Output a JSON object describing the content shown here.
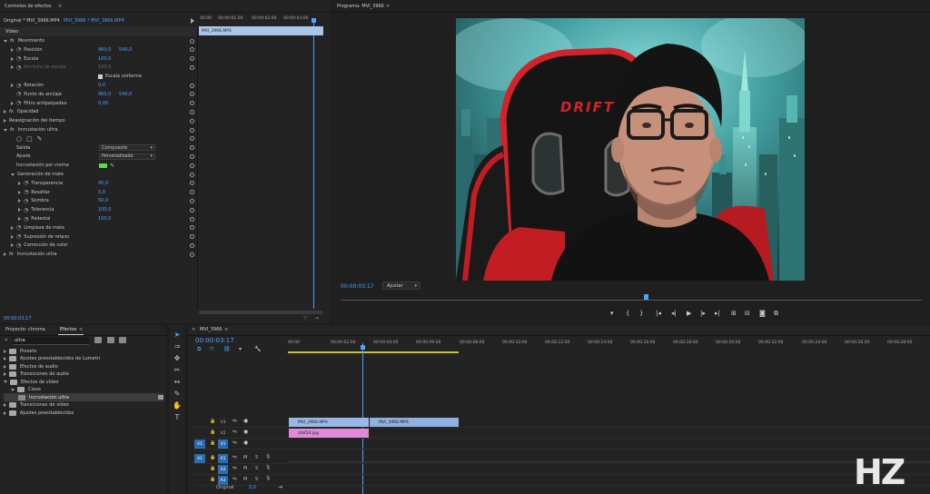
{
  "effect_controls": {
    "tab_title": "Controles de efectos",
    "source_label": "Original * MVI_3966.MP4",
    "seq_label": "MVI_3966 * MVI_3966.MP4",
    "timecodes": [
      "00:00",
      "00:00:01:00",
      "00:00:02:00",
      "00:00:03:00"
    ],
    "clip_label": "MVI_3966.MP4",
    "section_video": "Vídeo",
    "current_time": "00:00:03:17",
    "rows": [
      {
        "indent": 1,
        "exp": "down",
        "fx": true,
        "label": "Movimiento",
        "v1": "",
        "v2": ""
      },
      {
        "indent": 2,
        "exp": "right",
        "fx": false,
        "label": "Posición",
        "v1": "960,0",
        "v2": "540,0"
      },
      {
        "indent": 2,
        "exp": "right",
        "fx": false,
        "label": "Escala",
        "v1": "100,0",
        "v2": ""
      },
      {
        "indent": 2,
        "exp": "right",
        "fx": false,
        "label": "Anchura de escala",
        "v1": "100,0",
        "v2": "",
        "dim": true
      },
      {
        "indent": 2,
        "exp": "none",
        "fx": false,
        "label": "",
        "v1": "Escala uniforme",
        "v2": "",
        "check": true
      },
      {
        "indent": 2,
        "exp": "right",
        "fx": false,
        "label": "Rotación",
        "v1": "0,0",
        "v2": ""
      },
      {
        "indent": 2,
        "exp": "none",
        "fx": false,
        "label": "Punto de anclaje",
        "v1": "960,0",
        "v2": "540,0"
      },
      {
        "indent": 2,
        "exp": "right",
        "fx": false,
        "label": "Filtro antiparpadeo",
        "v1": "0,00",
        "v2": ""
      },
      {
        "indent": 1,
        "exp": "right",
        "fx": true,
        "label": "Opacidad",
        "v1": "",
        "v2": ""
      },
      {
        "indent": 1,
        "exp": "right",
        "fx": false,
        "label": "Reasignación del tiempo",
        "v1": "",
        "v2": ""
      },
      {
        "indent": 1,
        "exp": "down",
        "fx": true,
        "label": "Incrustación ultra",
        "v1": "",
        "v2": ""
      },
      {
        "indent": 2,
        "exp": "none",
        "fx": false,
        "label": "",
        "v1": "",
        "v2": "",
        "shapes": true
      },
      {
        "indent": 2,
        "exp": "none",
        "fx": false,
        "label": "Salida",
        "v1": "Compuesto",
        "v2": "",
        "dropdown": true
      },
      {
        "indent": 2,
        "exp": "none",
        "fx": false,
        "label": "Ajuste",
        "v1": "Personalizado",
        "v2": "",
        "dropdown": true
      },
      {
        "indent": 2,
        "exp": "none",
        "fx": false,
        "label": "Incrustación por croma",
        "v1": "",
        "v2": "",
        "swatch": true
      },
      {
        "indent": 2,
        "exp": "down",
        "fx": false,
        "label": "Generación de mate",
        "v1": "",
        "v2": ""
      },
      {
        "indent": 3,
        "exp": "right",
        "fx": false,
        "label": "Transparencia",
        "v1": "45,0",
        "v2": ""
      },
      {
        "indent": 3,
        "exp": "right",
        "fx": false,
        "label": "Resaltar",
        "v1": "0,0",
        "v2": ""
      },
      {
        "indent": 3,
        "exp": "right",
        "fx": false,
        "label": "Sombra",
        "v1": "50,0",
        "v2": ""
      },
      {
        "indent": 3,
        "exp": "right",
        "fx": false,
        "label": "Tolerancia",
        "v1": "100,0",
        "v2": ""
      },
      {
        "indent": 3,
        "exp": "right",
        "fx": false,
        "label": "Pedestal",
        "v1": "100,0",
        "v2": ""
      },
      {
        "indent": 2,
        "exp": "right",
        "fx": false,
        "label": "Limpieza de mate",
        "v1": "",
        "v2": ""
      },
      {
        "indent": 2,
        "exp": "right",
        "fx": false,
        "label": "Supresión de retazo",
        "v1": "",
        "v2": ""
      },
      {
        "indent": 2,
        "exp": "right",
        "fx": false,
        "label": "Corrección de color",
        "v1": "",
        "v2": ""
      },
      {
        "indent": 1,
        "exp": "right",
        "fx": true,
        "label": "Incrustación ultra",
        "v1": "",
        "v2": ""
      }
    ]
  },
  "program": {
    "tab_title": "Programa: MVI_3966",
    "timecode": "00:00:03:17",
    "fit_label": "Ajustar",
    "chair_brand": "DRIFT"
  },
  "project": {
    "tab1": "Proyecto: chroma",
    "tab2": "Efectos",
    "search_value": "ultra",
    "items": [
      {
        "indent": 0,
        "exp": "right",
        "label": "Presets"
      },
      {
        "indent": 0,
        "exp": "right",
        "label": "Ajustes preestablecidos de Lumetri"
      },
      {
        "indent": 0,
        "exp": "right",
        "label": "Efectos de audio"
      },
      {
        "indent": 0,
        "exp": "right",
        "label": "Transiciones de audio"
      },
      {
        "indent": 0,
        "exp": "down",
        "label": "Efectos de vídeo"
      },
      {
        "indent": 1,
        "exp": "down",
        "label": "Clave"
      },
      {
        "indent": 2,
        "exp": "none",
        "label": "Incrustación ultra",
        "selected": true
      },
      {
        "indent": 0,
        "exp": "right",
        "label": "Transiciones de vídeo"
      },
      {
        "indent": 0,
        "exp": "right",
        "label": "Ajustes preestablecidos"
      }
    ]
  },
  "timeline": {
    "tab_title": "MVI_3966",
    "timecode": "00:00:03:17",
    "ruler": [
      "00:00",
      "00:00:02:00",
      "00:00:04:00",
      "00:00:06:00",
      "00:00:08:00",
      "00:00:10:00",
      "00:00:12:00",
      "00:00:14:00",
      "00:00:16:00",
      "00:00:18:00",
      "00:00:20:00",
      "00:00:22:00",
      "00:00:24:00",
      "00:00:26:00",
      "00:00:28:00",
      "00:00:30"
    ],
    "tracks": [
      {
        "name": "V3",
        "type": "video",
        "src": ""
      },
      {
        "name": "V2",
        "type": "video",
        "src": ""
      },
      {
        "name": "V1",
        "type": "video",
        "src": "V1"
      },
      {
        "name": "A1",
        "type": "audio",
        "src": "A1"
      },
      {
        "name": "A2",
        "type": "audio",
        "src": ""
      },
      {
        "name": "A3",
        "type": "audio",
        "src": ""
      }
    ],
    "clips": {
      "v2a": "MVI_3966.MP4",
      "v2b": "MVI_3966.MP4",
      "v1": "afaf24.jpg"
    },
    "original_label": "Original",
    "original_value": "0,0",
    "mute_label": "M",
    "solo_label": "S"
  },
  "logo": {
    "text": "HZ"
  }
}
